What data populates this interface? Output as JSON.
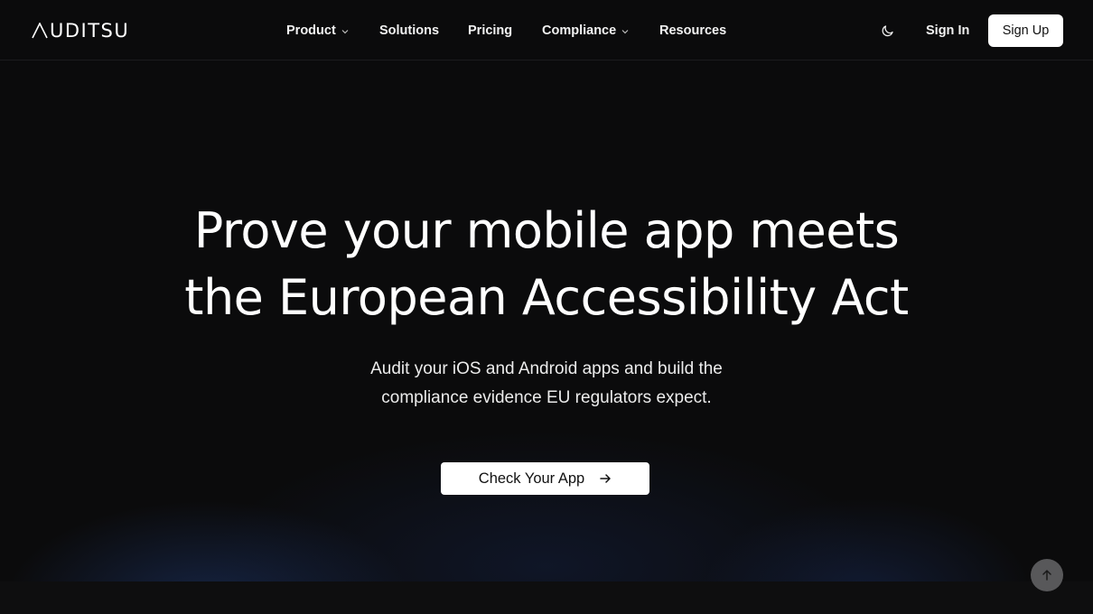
{
  "brand": {
    "logo_text": "UDITSU"
  },
  "nav": {
    "items": [
      {
        "label": "Product",
        "has_dropdown": true
      },
      {
        "label": "Solutions",
        "has_dropdown": false
      },
      {
        "label": "Pricing",
        "has_dropdown": false
      },
      {
        "label": "Compliance",
        "has_dropdown": true
      },
      {
        "label": "Resources",
        "has_dropdown": false
      }
    ]
  },
  "header_actions": {
    "theme_icon": "moon-icon",
    "sign_in_label": "Sign In",
    "sign_up_label": "Sign Up"
  },
  "hero": {
    "title_line1": "Prove your mobile app meets",
    "title_line2": "the European Accessibility Act",
    "subtitle_line1": "Audit your iOS and Android apps and build the",
    "subtitle_line2": "compliance evidence EU regulators expect.",
    "cta_label": "Check Your App",
    "cta_icon": "arrow-right-icon"
  },
  "scroll_top_icon": "arrow-up-icon",
  "colors": {
    "background": "#0b0b0c",
    "text": "#ffffff",
    "button_bg": "#ffffff",
    "button_text": "#111111",
    "glow": "#1e376e",
    "scroll_button": "#58585a"
  }
}
